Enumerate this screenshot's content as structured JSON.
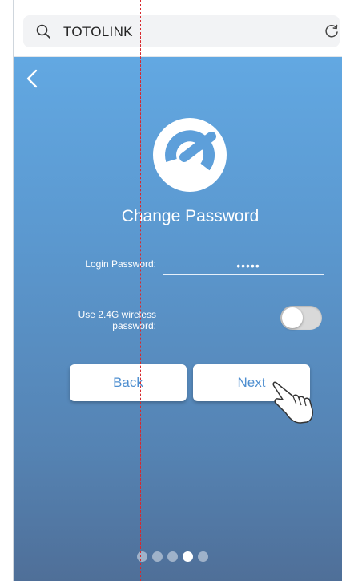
{
  "browser": {
    "search_text": "TOTOLINK",
    "search_icon": "search-icon",
    "reload_icon": "reload-icon"
  },
  "screen": {
    "back_icon": "chevron-left-icon",
    "logo": "totolink-logo",
    "title": "Change Password",
    "login_password_label": "Login Password:",
    "login_password_value": "•••••",
    "wireless_label": "Use 2.4G wireless password:",
    "wireless_toggle_on": false,
    "back_button": "Back",
    "next_button": "Next",
    "pager": {
      "count": 5,
      "active_index": 3
    }
  },
  "colors": {
    "gradient_top": "#62a8e2",
    "gradient_bottom": "#4f6f98",
    "button_text": "#4f8fd0",
    "guide_line": "#d8282d"
  }
}
